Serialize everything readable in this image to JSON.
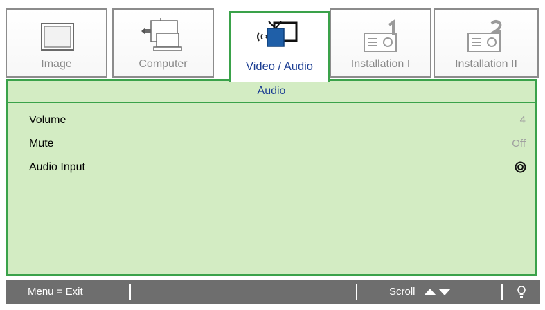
{
  "tabs": [
    {
      "label": "Image",
      "icon": "image-frame-icon",
      "active": false
    },
    {
      "label": "Computer",
      "icon": "computer-icon",
      "active": false
    },
    {
      "label": "Video / Audio",
      "icon": "video-audio-icon",
      "active": true
    },
    {
      "label": "Installation I",
      "icon": "projector-1-icon",
      "active": false
    },
    {
      "label": "Installation II",
      "icon": "projector-2-icon",
      "active": false
    }
  ],
  "section": {
    "title": "Audio"
  },
  "settings": [
    {
      "name": "Volume",
      "value": "4"
    },
    {
      "name": "Mute",
      "value": "Off"
    },
    {
      "name": "Audio Input",
      "value": ""
    }
  ],
  "footer": {
    "menu_exit": "Menu = Exit",
    "scroll": "Scroll"
  },
  "colors": {
    "accent": "#3aa24a",
    "panel_bg": "#d3ecc3",
    "active_text": "#1c3e93",
    "footer_bg": "#6e6e6e"
  }
}
